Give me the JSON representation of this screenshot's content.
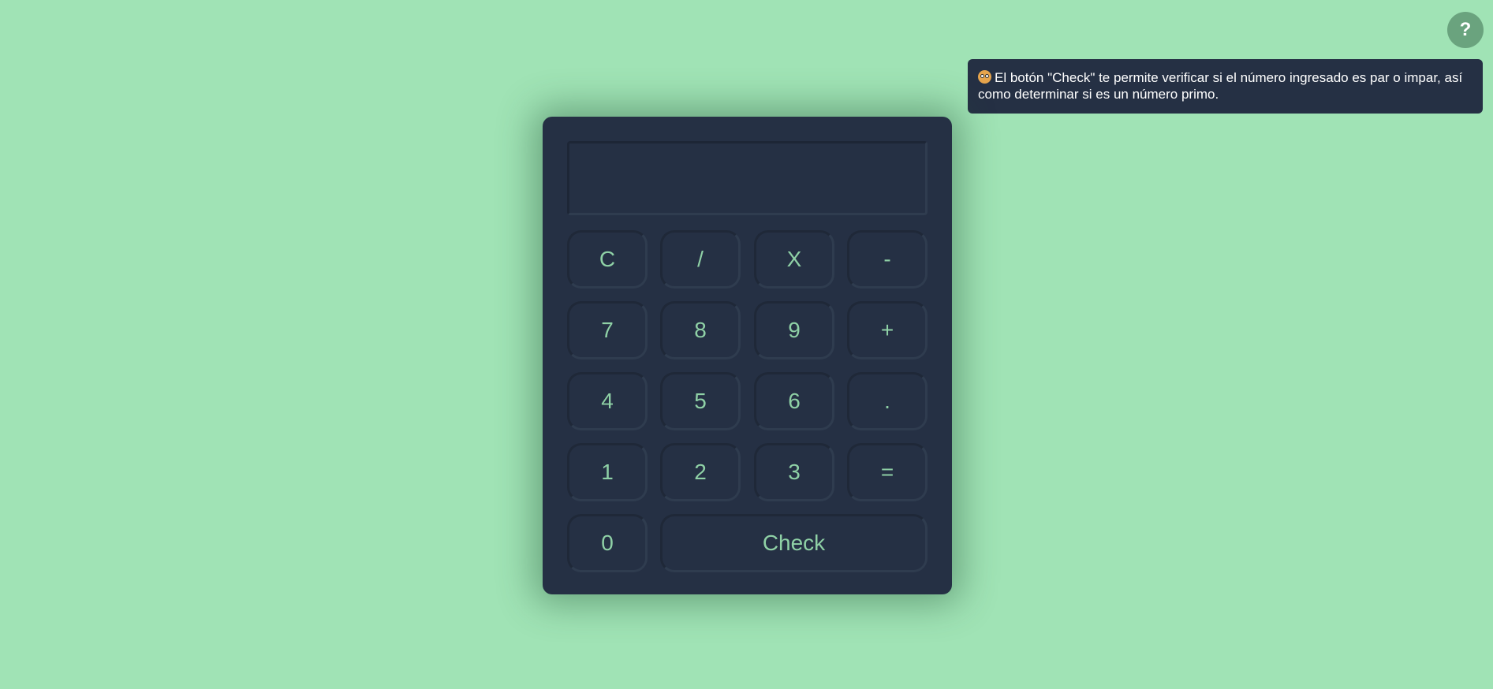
{
  "help_button": {
    "label": "?"
  },
  "tooltip": {
    "icon": "nerd-face-emoji",
    "text": "El botón \"Check\" te permite verificar si el número ingresado es par o impar, así como determinar si es un número primo."
  },
  "calculator": {
    "display_value": "",
    "keys": {
      "clear": "C",
      "divide": "/",
      "multiply": "X",
      "subtract": "-",
      "seven": "7",
      "eight": "8",
      "nine": "9",
      "add": "+",
      "four": "4",
      "five": "5",
      "six": "6",
      "decimal": ".",
      "one": "1",
      "two": "2",
      "three": "3",
      "equals": "=",
      "zero": "0",
      "check": "Check"
    }
  },
  "colors": {
    "background": "#a0e3b5",
    "calculator_body": "#253044",
    "key_text": "#8fd1a6",
    "help_button": "#6aa37e"
  }
}
